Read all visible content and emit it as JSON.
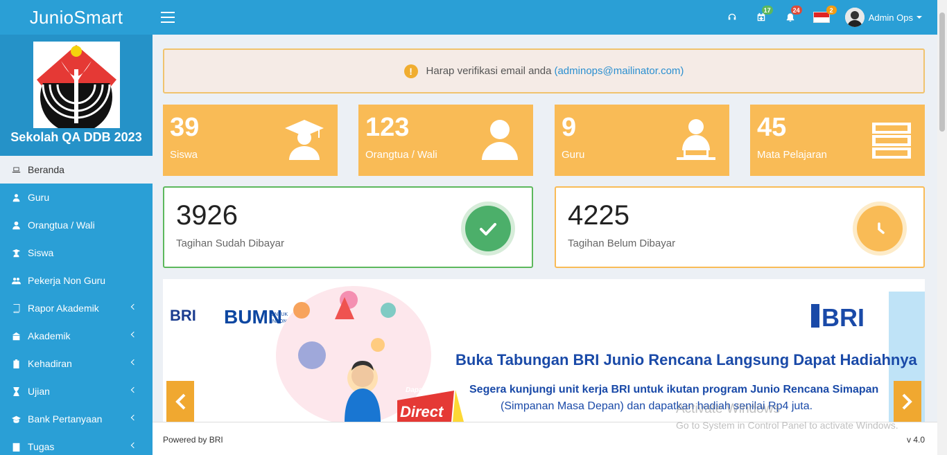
{
  "app": {
    "title": "JunioSmart"
  },
  "header": {
    "badges": {
      "calendar": "17",
      "notifications": "24",
      "language": "2"
    },
    "user_name": "Admin Ops"
  },
  "sidebar": {
    "school_name": "Sekolah QA DDB 2023",
    "items": [
      {
        "label": "Beranda",
        "icon": "laptop-icon"
      },
      {
        "label": "Guru",
        "icon": "teacher-icon"
      },
      {
        "label": "Orangtua / Wali",
        "icon": "user-icon"
      },
      {
        "label": "Siswa",
        "icon": "student-icon"
      },
      {
        "label": "Pekerja Non Guru",
        "icon": "users-icon"
      },
      {
        "label": "Rapor Akademik",
        "icon": "book-icon"
      },
      {
        "label": "Akademik",
        "icon": "school-icon"
      },
      {
        "label": "Kehadiran",
        "icon": "clipboard-icon"
      },
      {
        "label": "Ujian",
        "icon": "hourglass-icon"
      },
      {
        "label": "Bank Pertanyaan",
        "icon": "graduation-cap-icon"
      },
      {
        "label": "Tugas",
        "icon": "tasks-icon"
      }
    ]
  },
  "alert": {
    "text": "Harap verifikasi email anda",
    "email": "(adminops@mailinator.com)"
  },
  "stats": [
    {
      "value": "39",
      "label": "Siswa"
    },
    {
      "value": "123",
      "label": "Orangtua / Wali"
    },
    {
      "value": "9",
      "label": "Guru"
    },
    {
      "value": "45",
      "label": "Mata Pelajaran"
    }
  ],
  "bills": {
    "paid": {
      "value": "3926",
      "label": "Tagihan Sudah Dibayar"
    },
    "unpaid": {
      "value": "4225",
      "label": "Tagihan Belum Dibayar"
    }
  },
  "banner": {
    "logo_left": "BRI",
    "bumn": "BUMN",
    "bumn_sub1": "UNTUK",
    "bumn_sub2": "INDONESIA",
    "logo_right": "BRI",
    "headline": "Buka Tabungan BRI Junio Rencana Langsung Dapat Hadiahnya",
    "body_line1": "Segera kunjungi unit kerja BRI untuk ikutan program Junio Rencana Simapan",
    "body_line2": "(Simpanan Masa Depan) dan dapatkan hadiah senilai Rp4 juta.",
    "promo_small": "Dapatkan",
    "promo_big": "Direct"
  },
  "footer": {
    "powered": "Powered by BRI",
    "version": "v 4.0"
  },
  "watermark": {
    "title": "Activate Windows",
    "subtitle": "Go to System in Control Panel to activate Windows."
  },
  "colors": {
    "primary": "#2a9fd6",
    "stat_orange": "#f9bb56",
    "success": "#4caf6a",
    "warning": "#f9bb56"
  }
}
